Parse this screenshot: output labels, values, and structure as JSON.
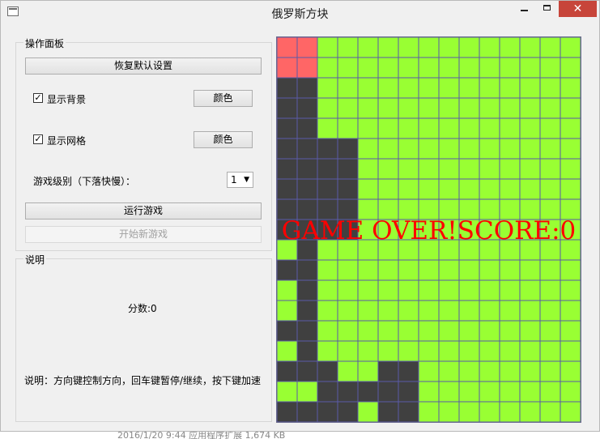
{
  "window": {
    "title": "俄罗斯方块",
    "min_symbol": "",
    "close_symbol": "✕"
  },
  "control_panel": {
    "title": "操作面板",
    "reset_button": "恢复默认设置",
    "show_background_label": "显示背景",
    "show_background_checked": true,
    "show_grid_label": "显示网格",
    "show_grid_checked": true,
    "color_button_bg": "颜色",
    "color_button_grid": "颜色",
    "level_label": "游戏级别（下落快慢）：",
    "level_value": "1",
    "run_button": "运行游戏",
    "new_game_button": "开始新游戏"
  },
  "info_panel": {
    "title": "说明",
    "score_text": "分数:0",
    "instructions": "说明：方向键控制方向，回车键暂停/继续，按下键加速"
  },
  "game": {
    "overlay_text": "GAME OVER!SCORE:0",
    "cols": 15,
    "rows": 19,
    "colors": {
      "background": "#99ff33",
      "block": "#404040",
      "active": "#ff6666",
      "grid": "#5a5aa8"
    },
    "block_rows": [
      "",
      "",
      "0,1",
      "0,1",
      "0,1",
      "0,1,2,3",
      "0,1,2,3",
      "0,1,2,3",
      "0,1,2,3",
      "0,1,2,3",
      "1",
      "0,1",
      "1",
      "1",
      "0,1",
      "1",
      "0,1,2,5,6",
      "2,3,4,5,6",
      "0,1,2,3,5,6"
    ],
    "active_rows": [
      "0,1",
      "0,1"
    ]
  },
  "taskbar_text": "2016/1/20 9:44    应用程序扩展    1,674 KB"
}
